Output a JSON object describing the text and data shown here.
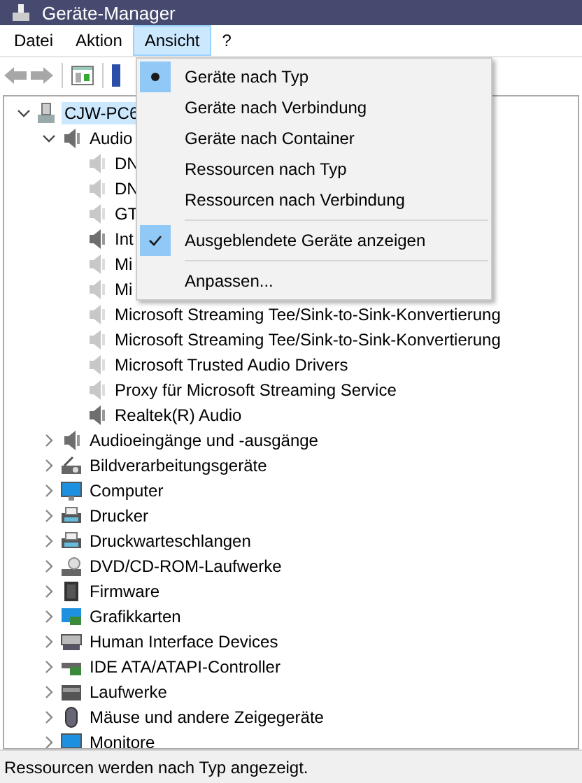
{
  "window": {
    "title": "Geräte-Manager"
  },
  "menu_bar": [
    {
      "label": "Datei",
      "selected": false
    },
    {
      "label": "Aktion",
      "selected": false
    },
    {
      "label": "Ansicht",
      "selected": true
    },
    {
      "label": "?",
      "selected": false
    }
  ],
  "view_menu": [
    {
      "kind": "radio",
      "label": "Geräte nach Typ",
      "checked": true
    },
    {
      "kind": "radio",
      "label": "Geräte nach Verbindung",
      "checked": false
    },
    {
      "kind": "radio",
      "label": "Geräte nach Container",
      "checked": false
    },
    {
      "kind": "radio",
      "label": "Ressourcen nach Typ",
      "checked": false
    },
    {
      "kind": "radio",
      "label": "Ressourcen nach Verbindung",
      "checked": false
    },
    {
      "kind": "separator"
    },
    {
      "kind": "check",
      "label": "Ausgeblendete Geräte anzeigen",
      "checked": true
    },
    {
      "kind": "separator"
    },
    {
      "kind": "command",
      "label": "Anpassen..."
    }
  ],
  "tree": [
    {
      "label": "CJW-PC6",
      "kind": "computer",
      "expanded": true,
      "selected": true,
      "children": [
        {
          "label": "Audio",
          "kind": "speaker",
          "expanded": true,
          "selected": false,
          "children": [
            {
              "label": "DN",
              "kind": "speaker",
              "hidden": true
            },
            {
              "label": "DN",
              "kind": "speaker",
              "hidden": true
            },
            {
              "label": "GT",
              "kind": "speaker",
              "hidden": true
            },
            {
              "label": "Int",
              "kind": "speaker",
              "hidden": false
            },
            {
              "label": "Mi",
              "kind": "speaker",
              "hidden": true
            },
            {
              "label": "Mi",
              "kind": "speaker",
              "hidden": true
            },
            {
              "label": "Microsoft Streaming Tee/Sink-to-Sink-Konvertierung",
              "kind": "speaker",
              "hidden": true
            },
            {
              "label": "Microsoft Streaming Tee/Sink-to-Sink-Konvertierung",
              "kind": "speaker",
              "hidden": true
            },
            {
              "label": "Microsoft Trusted Audio Drivers",
              "kind": "speaker",
              "hidden": true
            },
            {
              "label": "Proxy für Microsoft Streaming Service",
              "kind": "speaker",
              "hidden": true
            },
            {
              "label": "Realtek(R) Audio",
              "kind": "speaker",
              "hidden": false
            }
          ]
        },
        {
          "label": "Audioeingänge und -ausgänge",
          "kind": "speaker",
          "expanded": false,
          "selected": false
        },
        {
          "label": "Bildverarbeitungsgeräte",
          "kind": "camera",
          "expanded": false,
          "selected": false
        },
        {
          "label": "Computer",
          "kind": "monitor",
          "expanded": false,
          "selected": false
        },
        {
          "label": "Drucker",
          "kind": "printer",
          "expanded": false,
          "selected": false
        },
        {
          "label": "Druckwarteschlangen",
          "kind": "printer",
          "expanded": false,
          "selected": false
        },
        {
          "label": "DVD/CD-ROM-Laufwerke",
          "kind": "disc",
          "expanded": false,
          "selected": false
        },
        {
          "label": "Firmware",
          "kind": "chip",
          "expanded": false,
          "selected": false
        },
        {
          "label": "Grafikkarten",
          "kind": "card",
          "expanded": false,
          "selected": false
        },
        {
          "label": "Human Interface Devices",
          "kind": "keyboard",
          "expanded": false,
          "selected": false
        },
        {
          "label": "IDE ATA/ATAPI-Controller",
          "kind": "board",
          "expanded": false,
          "selected": false
        },
        {
          "label": "Laufwerke",
          "kind": "drive",
          "expanded": false,
          "selected": false
        },
        {
          "label": "Mäuse und andere Zeigegeräte",
          "kind": "mouse",
          "expanded": false,
          "selected": false
        },
        {
          "label": "Monitore",
          "kind": "monitor",
          "expanded": false,
          "selected": false
        }
      ]
    }
  ],
  "status_bar": "Ressourcen werden nach Typ angezeigt."
}
